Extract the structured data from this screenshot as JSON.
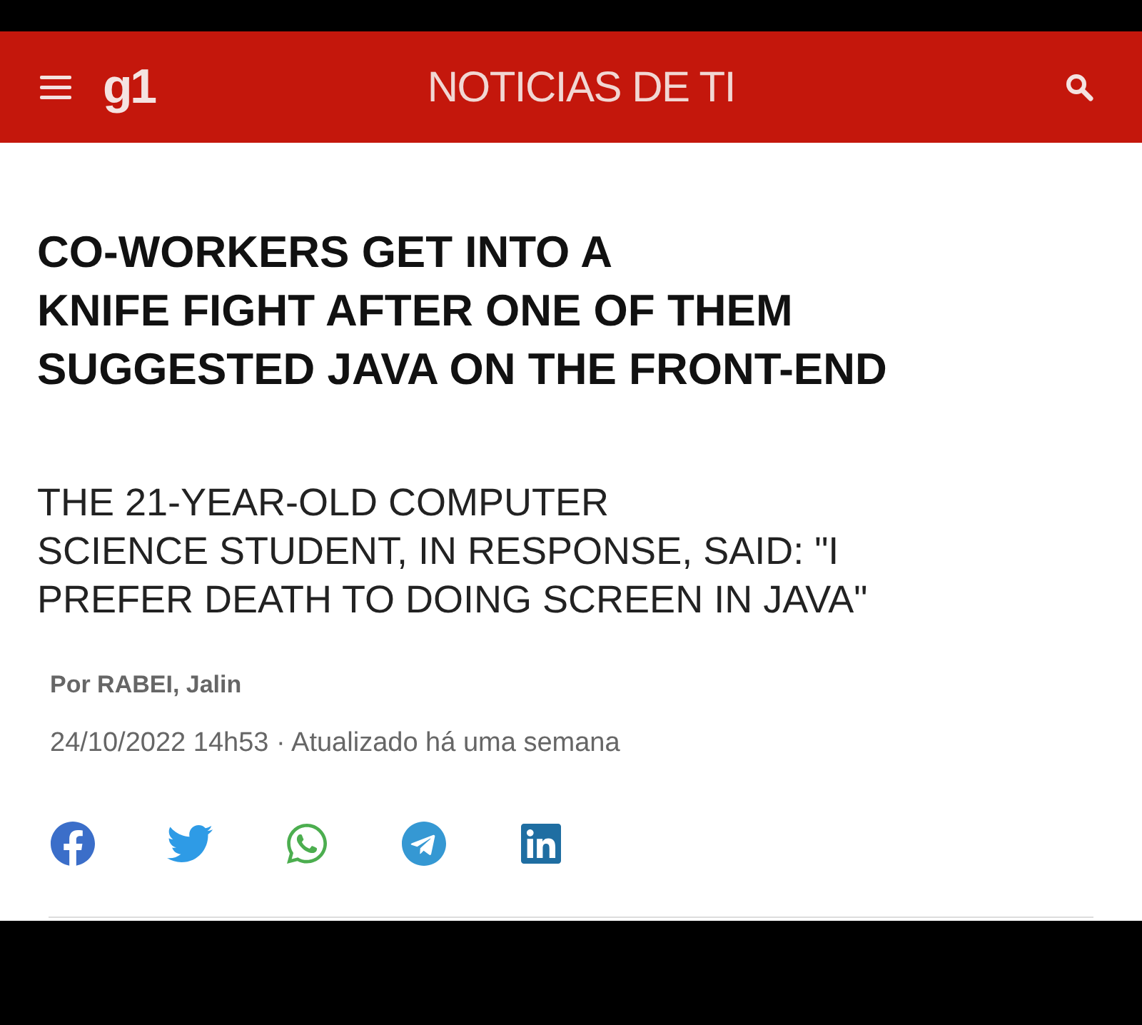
{
  "header": {
    "logo": "g1",
    "section_title": "NOTICIAS DE TI"
  },
  "article": {
    "headline": "CO-WORKERS GET INTO A\nKNIFE FIGHT AFTER ONE OF THEM\nSUGGESTED JAVA ON THE FRONT-END",
    "subtitle": "THE 21-YEAR-OLD COMPUTER\nSCIENCE STUDENT, IN RESPONSE, SAID: \"I\nPREFER DEATH TO DOING SCREEN IN JAVA\"",
    "byline": "Por RABEI, Jalin",
    "timestamp": "24/10/2022 14h53 · Atualizado há uma semana"
  }
}
